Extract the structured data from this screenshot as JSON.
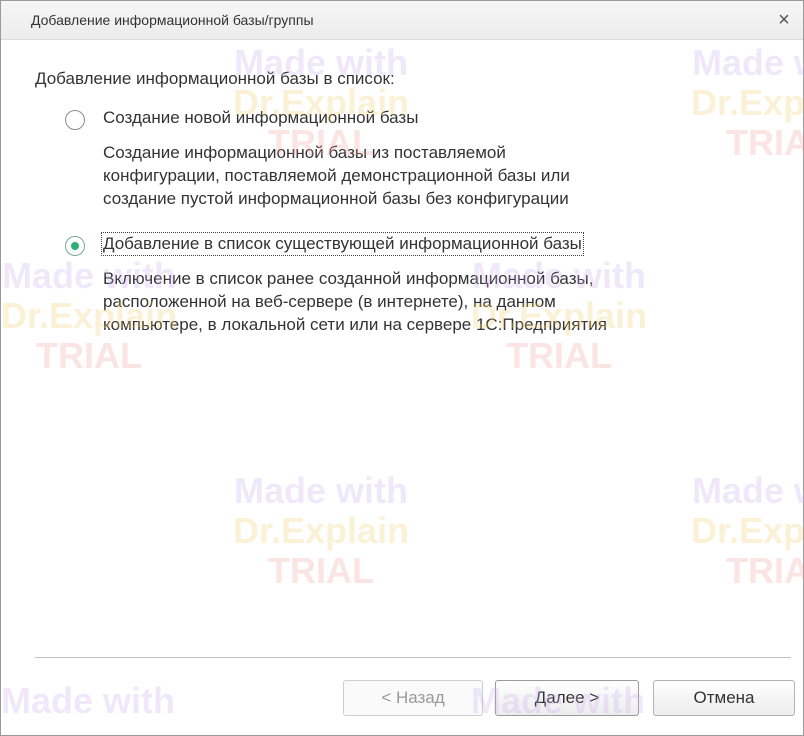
{
  "window": {
    "title": "Добавление информационной базы/группы",
    "close_glyph": "×"
  },
  "heading": "Добавление информационной базы в список:",
  "options": [
    {
      "label": "Создание новой информационной базы",
      "selected": false,
      "description": [
        "Создание информационной базы из поставляемой",
        "конфигурации, поставляемой демонстрационной базы или",
        "создание пустой информационной базы без конфигурации"
      ]
    },
    {
      "label": "Добавление в список существующей информационной базы",
      "selected": true,
      "description": [
        "Включение в список ранее созданной информационной базы,",
        "расположенной на веб-сервере (в интернете), на данном",
        "компьютере,  в локальной сети или на сервере 1С:Предприятия"
      ]
    }
  ],
  "buttons": {
    "back": "< Назад",
    "next": "Далее >",
    "cancel": "Отмена"
  },
  "watermark": {
    "line1": "Made with",
    "line2": "Dr.Explain",
    "line3": "TRIAL"
  },
  "colors": {
    "radio_selected": "#2bb074",
    "watermark_made": "#c8b0f0",
    "watermark_explain": "#f0d070",
    "watermark_trial": "#f0a0a0"
  }
}
